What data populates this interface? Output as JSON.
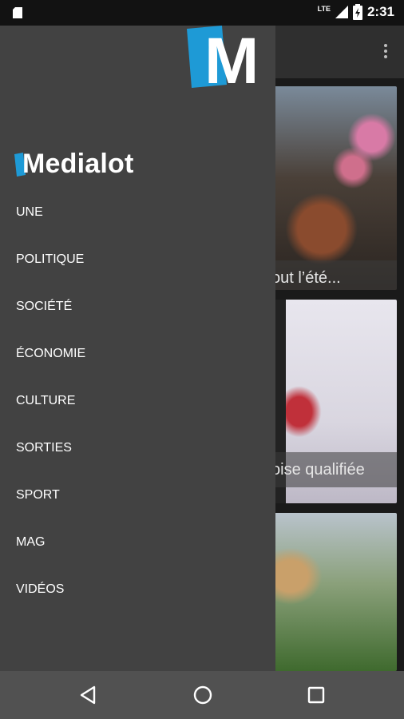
{
  "status_bar": {
    "time": "2:31",
    "network": "LTE"
  },
  "brand": {
    "name": "Medialot",
    "logo_letter": "M",
    "accent": "#1e9ad6"
  },
  "menu": [
    {
      "label": "UNE"
    },
    {
      "label": "POLITIQUE"
    },
    {
      "label": "SOCIÉTÉ"
    },
    {
      "label": "ÉCONOMIE"
    },
    {
      "label": "CULTURE"
    },
    {
      "label": "SORTIES"
    },
    {
      "label": "SPORT"
    },
    {
      "label": "MAG"
    },
    {
      "label": "VIDÉOS"
    }
  ],
  "articles": [
    {
      "caption": "out l’été..."
    },
    {
      "caption": "oise qualifiée"
    },
    {
      "caption": ""
    }
  ],
  "nav_bar": {
    "back": "back-icon",
    "home": "home-icon",
    "recents": "recents-icon"
  }
}
